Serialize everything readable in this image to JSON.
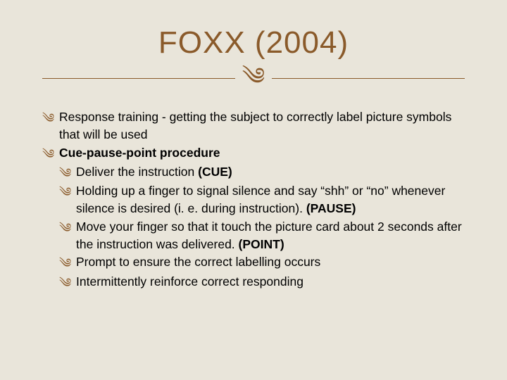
{
  "title": "FOXX (2004)",
  "flourish": "༄",
  "items": [
    {
      "text": "Response training -  getting the subject to correctly label picture symbols that will be used",
      "sub": []
    },
    {
      "text": "Cue-pause-point procedure",
      "bold": true,
      "sub": [
        {
          "pre": "Deliver the instruction ",
          "boldTail": "(CUE)"
        },
        {
          "pre": "Holding up a finger to signal silence and say “shh” or “no” whenever silence is desired (i. e. during instruction). ",
          "boldTail": "(PAUSE)"
        },
        {
          "pre": "Move your finger so that it touch the picture card about 2 seconds after the instruction was delivered. ",
          "boldTail": "(POINT)"
        },
        {
          "pre": "Prompt to ensure the correct labelling occurs",
          "boldTail": ""
        },
        {
          "pre": "Intermittently reinforce correct responding",
          "boldTail": ""
        }
      ]
    }
  ]
}
